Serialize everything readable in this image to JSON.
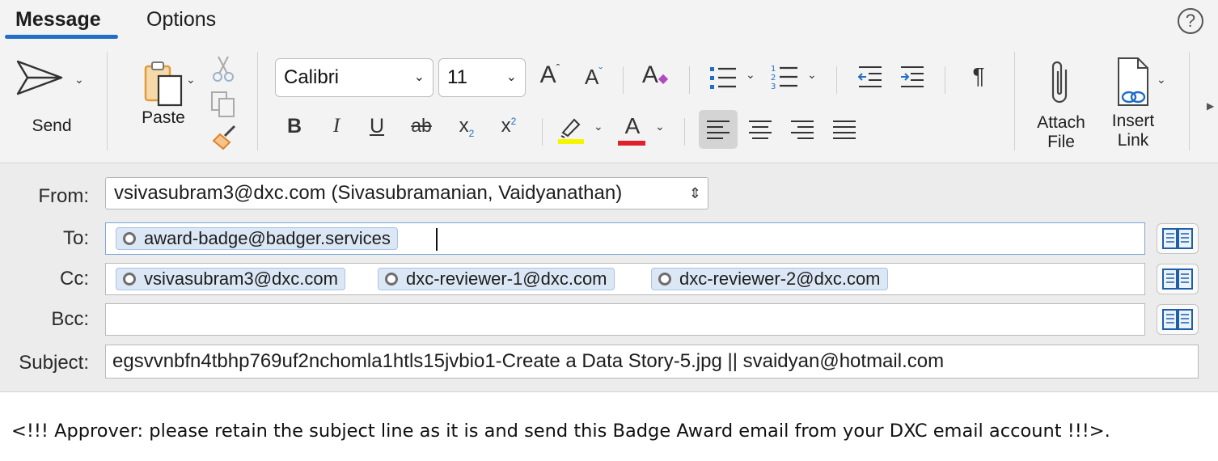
{
  "tabs": [
    {
      "label": "Message",
      "active": true
    },
    {
      "label": "Options",
      "active": false
    }
  ],
  "help": {
    "glyph": "?"
  },
  "ribbon": {
    "send_label": "Send",
    "paste_label": "Paste",
    "font_name": "Calibri",
    "font_size": "11",
    "attach_label_1": "Attach",
    "attach_label_2": "File",
    "insert_label_1": "Insert",
    "insert_label_2": "Link",
    "highlight_color": "#f5f500",
    "font_color": "#e0202a",
    "active_align_bg": "#d4d4d4"
  },
  "header": {
    "from_label": "From:",
    "from_value": "vsivasubram3@dxc.com (Sivasubramanian, Vaidyanathan)",
    "to_label": "To:",
    "to_recipients": [
      "award-badge@badger.services"
    ],
    "cc_label": "Cc:",
    "cc_recipients": [
      "vsivasubram3@dxc.com",
      "dxc-reviewer-1@dxc.com",
      "dxc-reviewer-2@dxc.com"
    ],
    "bcc_label": "Bcc:",
    "subject_label": "Subject:",
    "subject_value": "egsvvnbfn4tbhp769uf2nchomla1htls15jvbio1-Create a Data Story-5.jpg || svaidyan@hotmail.com"
  },
  "body": {
    "text": "<!!! Approver: please retain the subject line as it is and send this Badge Award email from your DXC email account !!!>."
  }
}
